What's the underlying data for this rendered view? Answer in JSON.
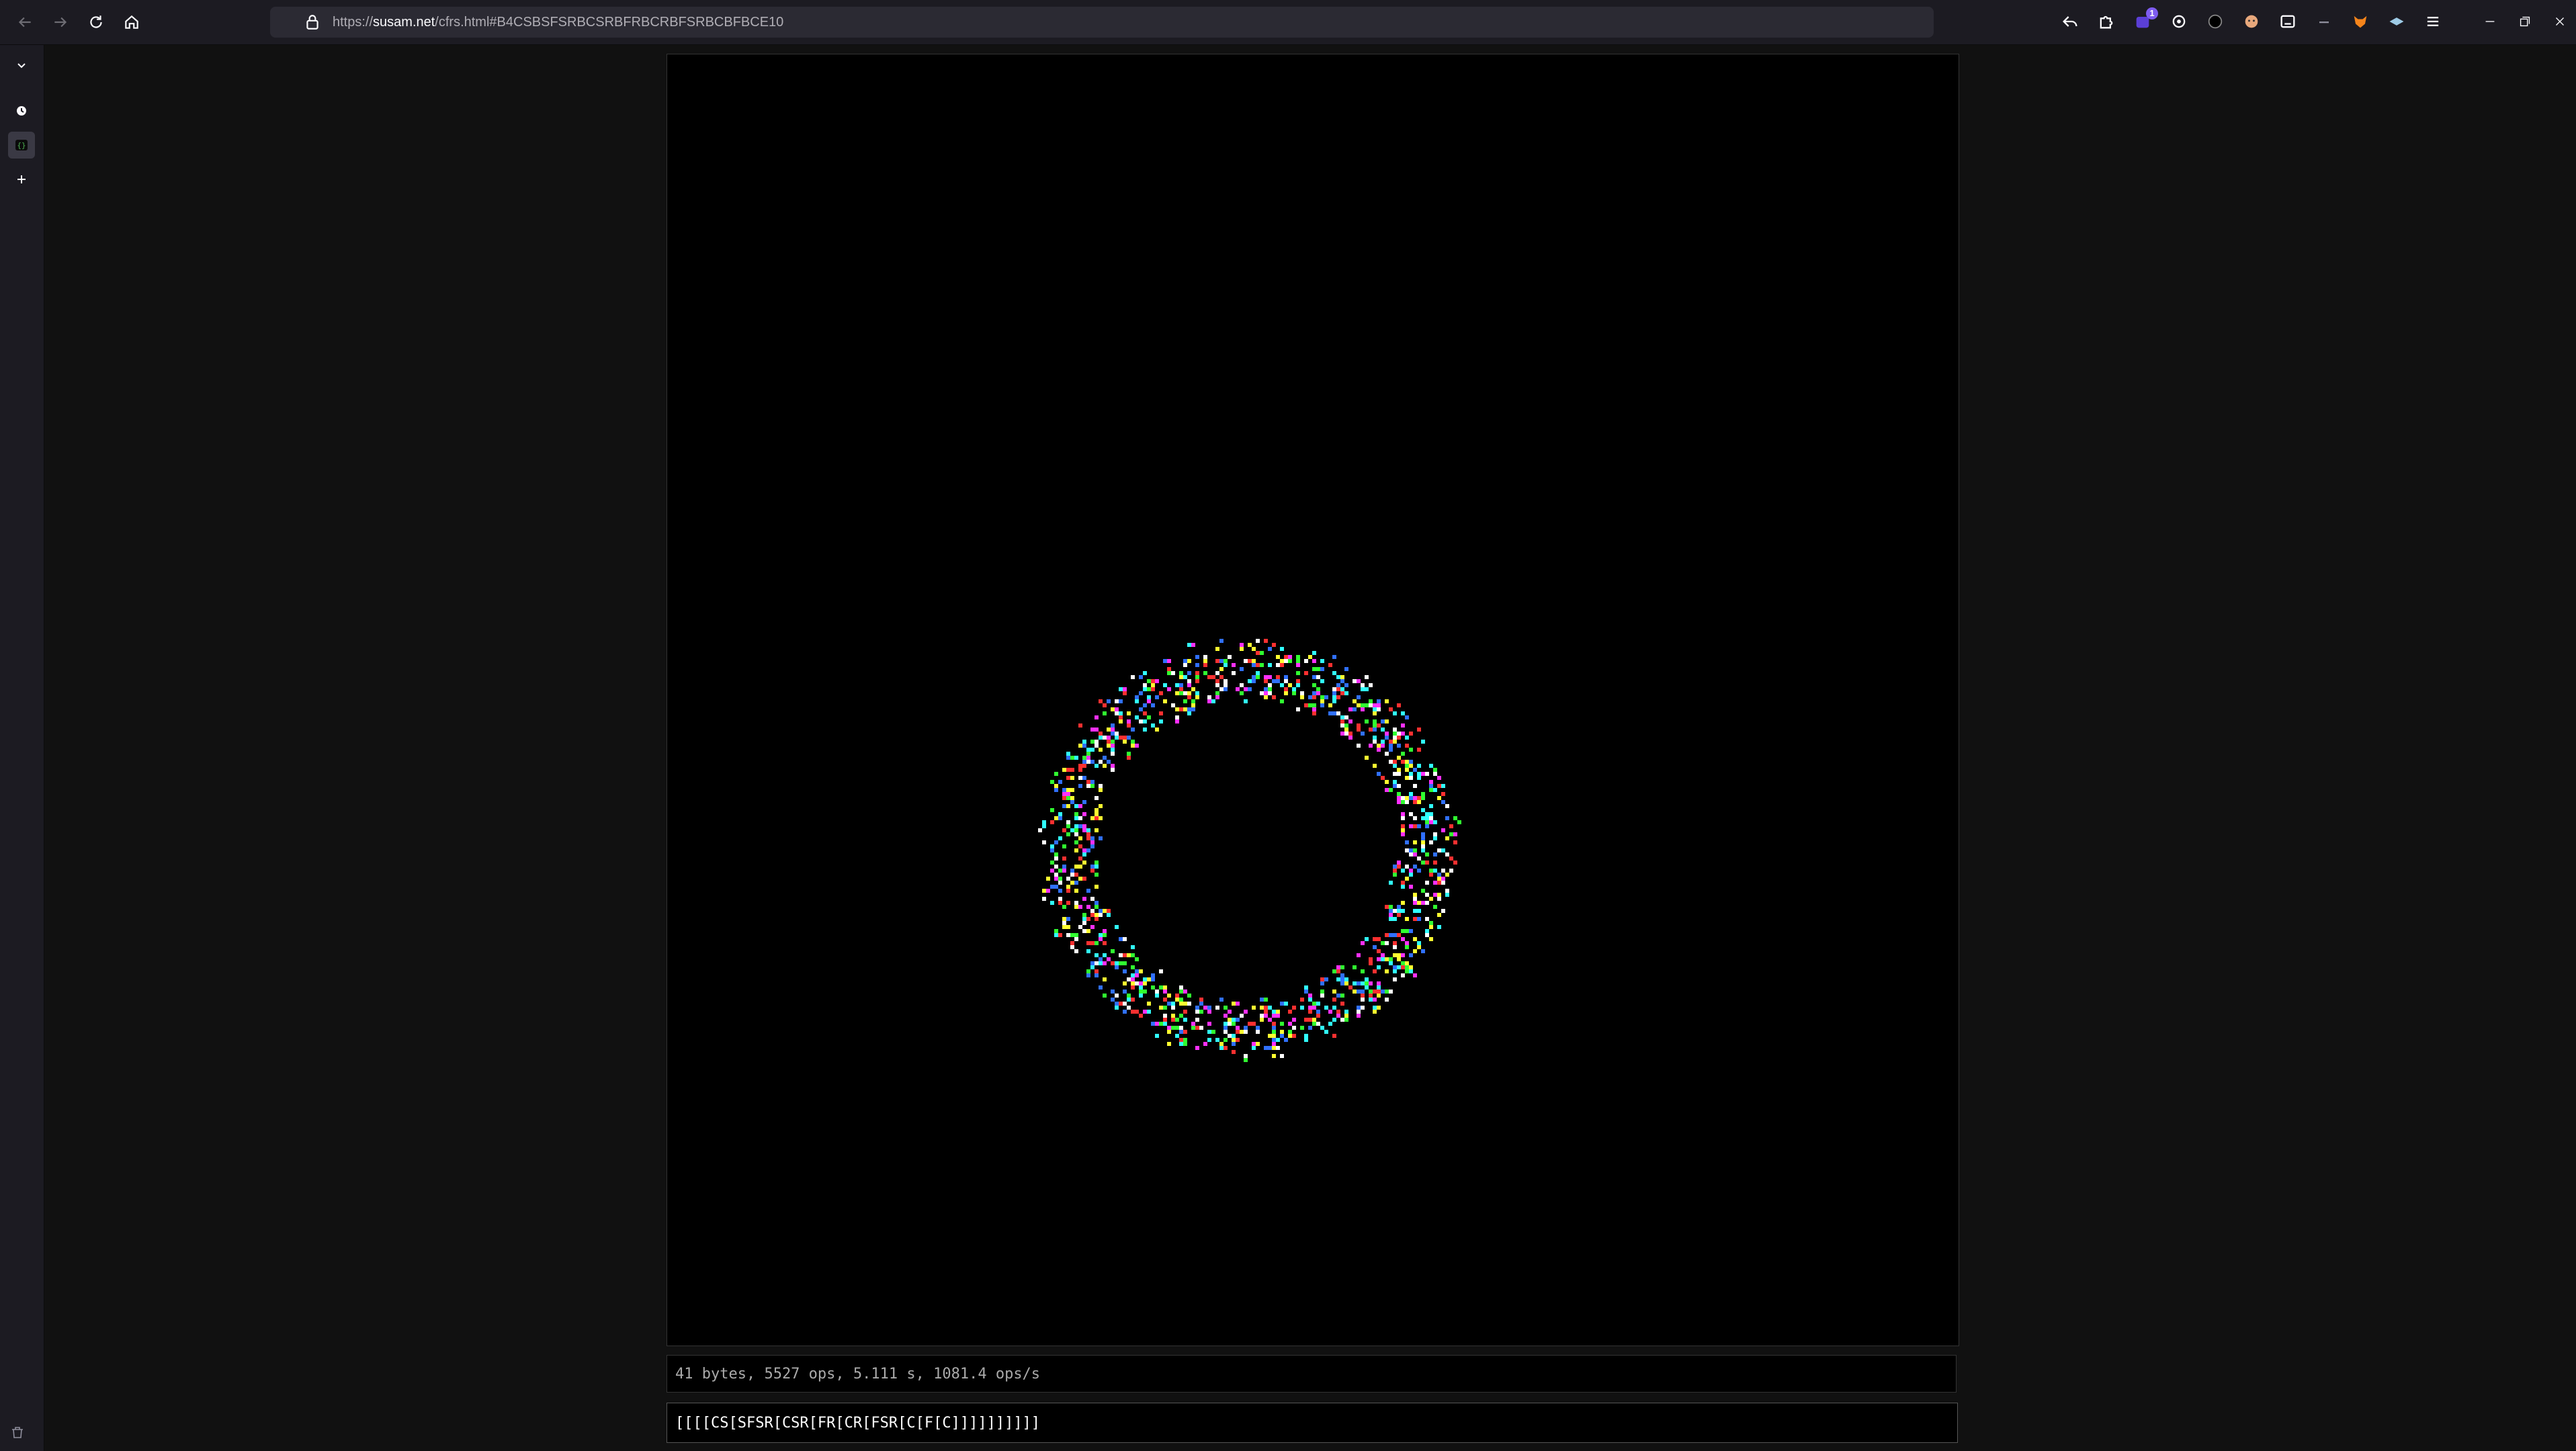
{
  "browser": {
    "url_scheme": "https://",
    "url_host": "susam.net",
    "url_path": "/cfrs.html#B4CSBSFSRBCSRBFRBCRBFSRBCBFBCE10",
    "extensions": [
      {
        "icon": "reply-arrow-icon"
      },
      {
        "icon": "puzzle-icon"
      },
      {
        "icon": "extension-badge-icon",
        "badge": "1"
      },
      {
        "icon": "gear-icon"
      },
      {
        "icon": "dark-circle-icon"
      },
      {
        "icon": "face-icon"
      },
      {
        "icon": "reader-icon"
      },
      {
        "icon": "dash-icon"
      },
      {
        "icon": "fox-icon"
      },
      {
        "icon": "hat-icon"
      },
      {
        "icon": "menu-icon"
      }
    ]
  },
  "sidebar": {
    "items": [
      {
        "icon": "chevron-down-icon"
      },
      {
        "icon": "history-icon"
      },
      {
        "icon": "code-braces-icon",
        "active": true
      },
      {
        "icon": "plus-icon"
      },
      {
        "icon": "trash-icon"
      }
    ]
  },
  "page": {
    "status": "41 bytes, 5527 ops, 5.111 s, 1081.4 ops/s",
    "code": "[[[[CS[SFSR[CSR[FR[CR[FSR[C[F[C]]]]]]]]]]",
    "palette": [
      "#ff3030",
      "#30ff30",
      "#3070ff",
      "#ff30ff",
      "#30ffff",
      "#ffff30",
      "#ffffff"
    ]
  }
}
